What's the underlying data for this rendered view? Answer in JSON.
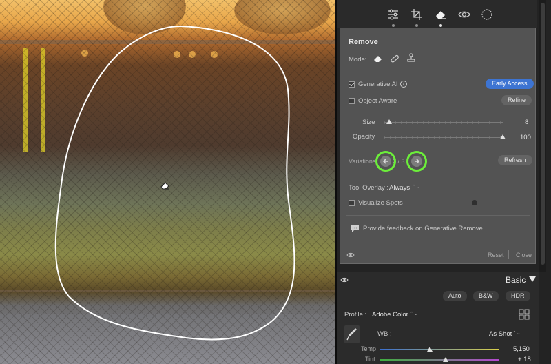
{
  "tool_strip": {
    "icons": [
      "edit-sliders-icon",
      "crop-icon",
      "remove-eraser-icon",
      "red-eye-icon",
      "masking-icon"
    ]
  },
  "remove_panel": {
    "title": "Remove",
    "mode_label": "Mode:",
    "generative_ai_label": "Generative AI",
    "generative_ai_checked": true,
    "early_access_label": "Early Access",
    "object_aware_label": "Object Aware",
    "object_aware_checked": false,
    "refine_label": "Refine",
    "size_label": "Size",
    "size_value": "8",
    "size_level": 0.04,
    "opacity_label": "Opacity",
    "opacity_value": "100",
    "opacity_level": 1.0,
    "variations_label": "Variations",
    "variations_counter": "2 / 3",
    "refresh_label": "Refresh",
    "tool_overlay_label": "Tool Overlay :",
    "tool_overlay_value": "Always",
    "visualize_spots_label": "Visualize Spots",
    "visualize_spots_checked": false,
    "visualize_spots_level": 0.55,
    "feedback_label": "Provide feedback on Generative Remove",
    "reset_label": "Reset",
    "close_label": "Close"
  },
  "basic_panel": {
    "title": "Basic",
    "auto_label": "Auto",
    "bw_label": "B&W",
    "hdr_label": "HDR",
    "profile_label": "Profile :",
    "profile_value": "Adobe Color",
    "wb_label": "WB :",
    "wb_value": "As Shot",
    "temp_label": "Temp",
    "temp_value": "5,150",
    "temp_level": 0.42,
    "tint_label": "Tint",
    "tint_value": "+ 18",
    "tint_level": 0.55
  },
  "colors": {
    "accent_blue": "#3d74d2",
    "highlight_ring": "#6cef3a",
    "panel_bg": "#535353"
  }
}
